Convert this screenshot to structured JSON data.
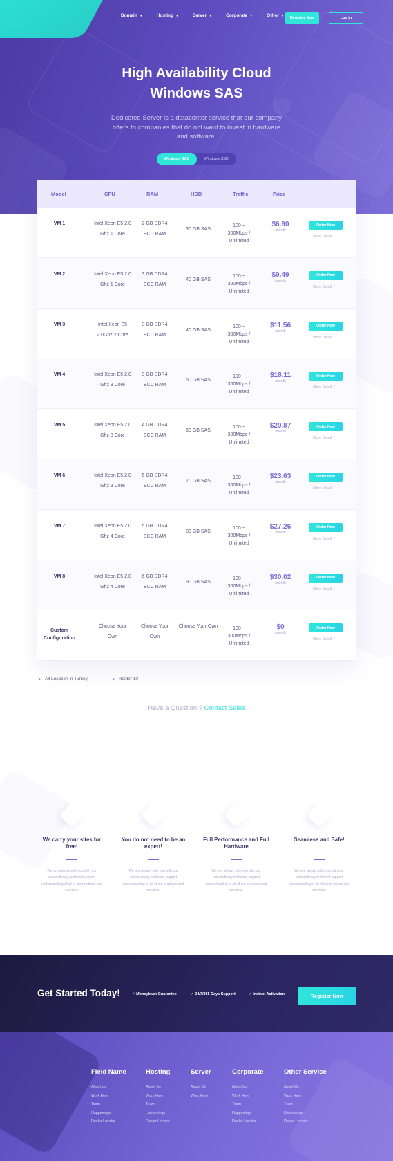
{
  "header": {
    "nav": [
      "Domain",
      "Hosting",
      "Server",
      "Corporate",
      "Other"
    ],
    "register": "Register Now",
    "login": "Log In"
  },
  "hero": {
    "title_line1": "High Availability Cloud",
    "title_line2": "Windows SAS",
    "subtitle": "Dedicated Server is a datacenter service that our company offers to companies that do not want to invest in hardware and software.",
    "toggle": [
      "Windows SAS",
      "Windows SSD"
    ]
  },
  "table": {
    "headers": [
      "Model",
      "CPU",
      "RAM",
      "HDD",
      "Traffic",
      "Price"
    ],
    "order_label": "Order Now",
    "more_label": "More Detail",
    "per_month": "/month",
    "rows": [
      {
        "model": "VM 1",
        "cpu1": "Intel Xeon E5 2.0",
        "cpu2": "Ghz 1 Core",
        "ram1": "2 GB DDR4",
        "ram2": "ECC RAM",
        "hdd": "30 GB SAS",
        "t1": "100 ~",
        "t2": "300Mbps /",
        "t3": "Unlimited",
        "price": "$6.90"
      },
      {
        "model": "VM 2",
        "cpu1": "Intel Xeon E5 2.0",
        "cpu2": "Ghz 1 Core",
        "ram1": "3 GB DDR4",
        "ram2": "ECC RAM",
        "hdd": "40 GB SAS",
        "t1": "100 ~",
        "t2": "300Mbps /",
        "t3": "Unlimited",
        "price": "$9.49"
      },
      {
        "model": "VM 3",
        "cpu1": "Intel Xeon E5",
        "cpu2": "2.0Ghz 2 Core",
        "ram1": "3 GB DDR4",
        "ram2": "ECC RAM",
        "hdd": "40 GB SAS",
        "t1": "100 ~",
        "t2": "300Mbps /",
        "t3": "Unlimited",
        "price": "$11.56"
      },
      {
        "model": "VM 4",
        "cpu1": "Intel Xeon E5 2.0",
        "cpu2": "Ghz 3 Core",
        "ram1": "3 GB DDR4",
        "ram2": "ECC RAM",
        "hdd": "50 GB SAS",
        "t1": "100 ~",
        "t2": "300Mbps /",
        "t3": "Unlimited",
        "price": "$18.11"
      },
      {
        "model": "VM 5",
        "cpu1": "Intel Xeon E5 2.0",
        "cpu2": "Ghz 3 Core",
        "ram1": "4 GB DDR4",
        "ram2": "ECC RAM",
        "hdd": "60 GB SAS",
        "t1": "100 ~",
        "t2": "300Mbps /",
        "t3": "Unlimited",
        "price": "$20.87"
      },
      {
        "model": "VM 6",
        "cpu1": "Intel Xeon E5 2.0",
        "cpu2": "Ghz 3 Core",
        "ram1": "5 GB DDR4",
        "ram2": "ECC RAM",
        "hdd": "70 GB SAS",
        "t1": "100 ~",
        "t2": "300Mbps /",
        "t3": "Unlimited",
        "price": "$23.63"
      },
      {
        "model": "VM 7",
        "cpu1": "Intel Xeon E5 2.0",
        "cpu2": "Ghz 4 Core",
        "ram1": "5 GB DDR4",
        "ram2": "ECC RAM",
        "hdd": "80 GB SAS",
        "t1": "100 ~",
        "t2": "300Mbps /",
        "t3": "Unlimited",
        "price": "$27.26"
      },
      {
        "model": "VM 8",
        "cpu1": "Intel Xeon E5 2.0",
        "cpu2": "Ghz 4 Core",
        "ram1": "6 GB DDR4",
        "ram2": "ECC RAM",
        "hdd": "90 GB SAS",
        "t1": "100 ~",
        "t2": "300Mbps /",
        "t3": "Unlimited",
        "price": "$30.02"
      },
      {
        "model": "Custom Configuration",
        "cpu1": "Choose Your",
        "cpu2": "Own",
        "ram1": "Choose Your",
        "ram2": "Own",
        "hdd": "Choose Your Own",
        "t1": "100 ~",
        "t2": "300Mbps /",
        "t3": "Unlimited",
        "price": "$0"
      }
    ]
  },
  "bullets": [
    "All Location in Turkey",
    "Raider 10"
  ],
  "question": {
    "text": "Have a Question ?",
    "link": "Contact Sales"
  },
  "features": [
    {
      "title": "We carry your sites for free!",
      "text": "We are always with you with our extraordinary technical support understanding of all of our products and services."
    },
    {
      "title": "You do not need to be an expert!",
      "text": "We are always with you with our extraordinary technical support understanding of all of our products and services."
    },
    {
      "title": "Full Performance and Full Hardware",
      "text": "We are always with you with our extraordinary technical support understanding of all of our products and services."
    },
    {
      "title": "Seamless and Safe!",
      "text": "We are always with you with our extraordinary technical support understanding of all of our products and services."
    }
  ],
  "cta": {
    "title": "Get Started Today!",
    "checks": [
      "Moneyback Guarantee",
      "24/7/365 Days Support",
      "Instant Activation"
    ],
    "button": "Register Now"
  },
  "footer": [
    {
      "title": "Field Name",
      "links": [
        "About Us",
        "Work Here",
        "Team",
        "Happenings",
        "Dealer Locator"
      ]
    },
    {
      "title": "Hosting",
      "links": [
        "About Us",
        "Work Here",
        "Team",
        "Happenings",
        "Dealer Locator"
      ]
    },
    {
      "title": "Server",
      "links": [
        "About Us",
        "Work Here"
      ]
    },
    {
      "title": "Corporate",
      "links": [
        "About Us",
        "Work Here",
        "Team",
        "Happenings",
        "Dealer Locator"
      ]
    },
    {
      "title": "Other Service",
      "links": [
        "About Us",
        "Work Here",
        "Team",
        "Happenings",
        "Dealer Locator"
      ]
    }
  ],
  "colors": {
    "accent": "#2fe6d9",
    "primary": "#5e4cc0",
    "price": "#7c6ad8",
    "dark": "#1c1a3f"
  }
}
